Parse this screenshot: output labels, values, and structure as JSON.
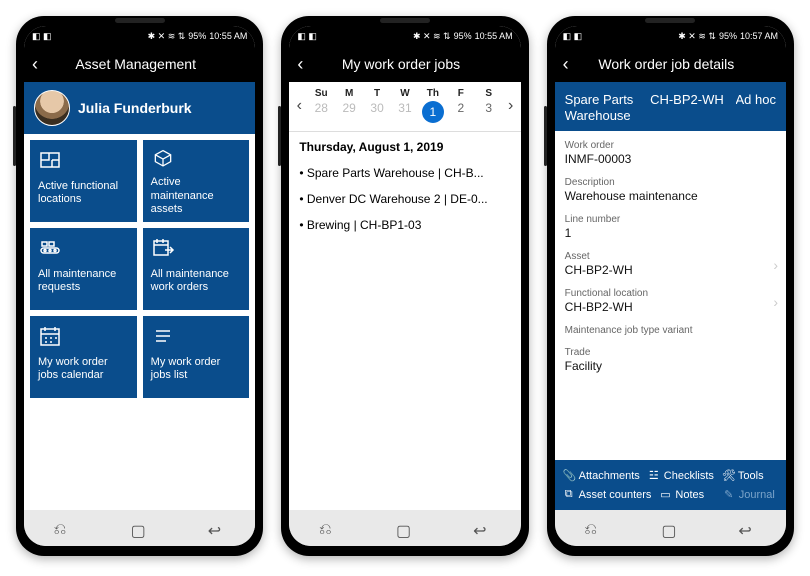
{
  "status": {
    "left_icons": "◧ ◧",
    "right_icons": "✱ ✕ ≋ ⇅",
    "battery": "95%",
    "time1": "10:55 AM",
    "time2": "10:55 AM",
    "time3": "10:57 AM"
  },
  "phone1": {
    "title": "Asset Management",
    "user": "Julia Funderburk",
    "tiles": [
      {
        "label": "Active functional locations"
      },
      {
        "label": "Active maintenance assets"
      },
      {
        "label": "All maintenance requests"
      },
      {
        "label": "All maintenance work orders"
      },
      {
        "label": "My work order jobs calendar"
      },
      {
        "label": "My work order jobs list"
      }
    ]
  },
  "phone2": {
    "title": "My work order jobs",
    "dow": [
      "Su",
      "M",
      "T",
      "W",
      "Th",
      "F",
      "S"
    ],
    "days": [
      {
        "n": "28",
        "mute": true
      },
      {
        "n": "29",
        "mute": true
      },
      {
        "n": "30",
        "mute": true
      },
      {
        "n": "31",
        "mute": true
      },
      {
        "n": "1",
        "sel": true
      },
      {
        "n": "2"
      },
      {
        "n": "3"
      }
    ],
    "date_label": "Thursday, August 1, 2019",
    "events": [
      "Spare Parts Warehouse | CH-B...",
      "Denver DC Warehouse 2 | DE-0...",
      "Brewing | CH-BP1-03"
    ]
  },
  "phone3": {
    "title": "Work order job details",
    "top": {
      "name": "Spare Parts Warehouse",
      "code": "CH-BP2-WH",
      "type": "Ad hoc"
    },
    "fields": {
      "work_order_lbl": "Work order",
      "work_order_val": "INMF-00003",
      "desc_lbl": "Description",
      "desc_val": "Warehouse maintenance",
      "line_lbl": "Line number",
      "line_val": "1",
      "asset_lbl": "Asset",
      "asset_val": "CH-BP2-WH",
      "floc_lbl": "Functional location",
      "floc_val": "CH-BP2-WH",
      "mjtv_lbl": "Maintenance job type variant",
      "trade_lbl": "Trade",
      "trade_val": "Facility"
    },
    "actions": {
      "attachments": "Attachments",
      "checklists": "Checklists",
      "tools": "Tools",
      "counters": "Asset counters",
      "notes": "Notes",
      "journal": "Journal"
    }
  }
}
